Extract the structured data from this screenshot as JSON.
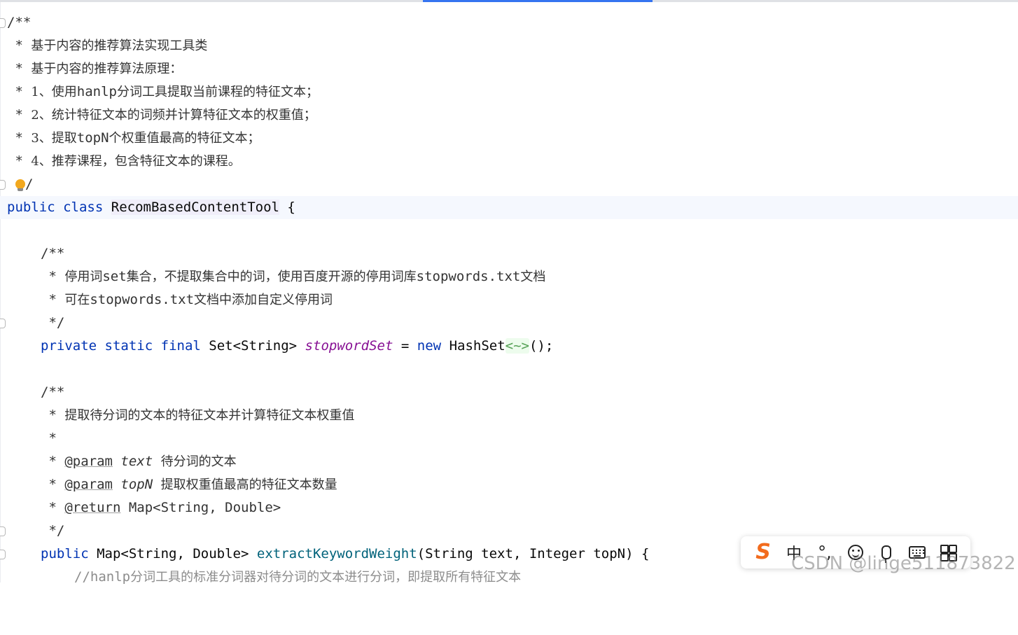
{
  "editor": {
    "header_doc": {
      "open": "/**",
      "line1": "基于内容的推荐算法实现工具类",
      "line2": "基于内容的推荐算法原理：",
      "line3_num": "1、使用",
      "line3_code": "hanlp",
      "line3_text": "分词工具提取当前课程的特征文本；",
      "line4_num": "2、",
      "line4_text": "统计特征文本的词频并计算特征文本的权重值；",
      "line5_num": "3、",
      "line5_a": "提取",
      "line5_code": "topN",
      "line5_b": "个权重值最高的特征文本；",
      "line6_num": "4、",
      "line6_text": "推荐课程，包含特征文本的课程。",
      "close": "/"
    },
    "class_decl": {
      "kw_public": "public",
      "kw_class": "class",
      "class_name": "RecomBasedContentTool",
      "brace": "{"
    },
    "field_doc": {
      "open": "/**",
      "line1_a": "停用词",
      "line1_code": "set",
      "line1_b": "集合，不提取集合中的词，使用百度开源的停用词库",
      "line1_code2": "stopwords.txt",
      "line1_c": "文档",
      "line2_a": "可在",
      "line2_code": "stopwords.txt",
      "line2_b": "文档中添加自定义停用词",
      "close": "*/"
    },
    "field_decl": {
      "kw_private": "private",
      "kw_static": "static",
      "kw_final": "final",
      "type": "Set<String>",
      "name": "stopwordSet",
      "assign": "=",
      "kw_new": "new",
      "ctor": "HashSet",
      "hint": "<~>",
      "tail": "();"
    },
    "method_doc": {
      "open": "/**",
      "line1": "提取待分词的文本的特征文本并计算特征文本权重值",
      "param_tag": "@param",
      "param1_name": "text",
      "param1_desc": "待分词的文本",
      "param2_name": "topN",
      "param2_desc": "提取权重值最高的特征文本数量",
      "return_tag": "@return",
      "return_desc": "Map<String, Double>",
      "close": "*/"
    },
    "method_decl": {
      "kw_public": "public",
      "return_type": "Map<String, Double>",
      "name": "extractKeywordWeight",
      "params": "(String text, Integer topN) {"
    },
    "line_comment": {
      "slashes": "//",
      "code": "hanlp",
      "text": "分词工具的标准分词器对待分词的文本进行分词，即提取所有特征文本"
    }
  },
  "ime_toolbar": {
    "logo": "S",
    "mode": "中",
    "punct": "°,"
  },
  "watermark": "CSDN @linge511873822",
  "colors": {
    "keyword": "#0033b3",
    "field": "#871094",
    "method": "#00627a",
    "accent": "#3574f0",
    "ime_logo": "#f26b1d"
  }
}
